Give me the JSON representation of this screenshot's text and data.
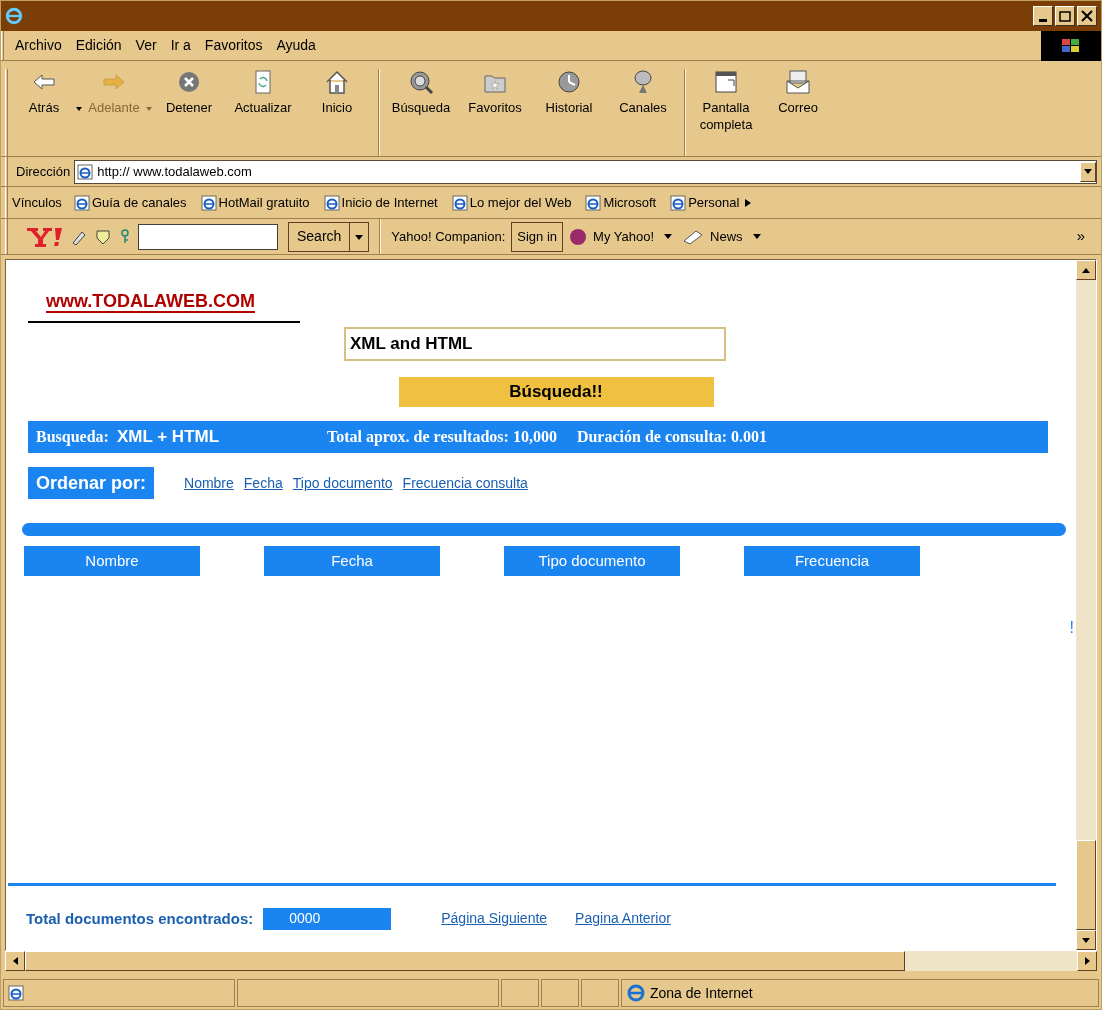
{
  "menu": [
    "Archivo",
    "Edición",
    "Ver",
    "Ir a",
    "Favoritos",
    "Ayuda"
  ],
  "toolbar": [
    {
      "label": "Atrás",
      "kind": "back",
      "disabled": false,
      "dropdown": true
    },
    {
      "label": "Adelante",
      "kind": "forward",
      "disabled": true,
      "dropdown": true
    },
    {
      "label": "Detener",
      "kind": "stop",
      "disabled": false,
      "dropdown": false
    },
    {
      "label": "Actualizar",
      "kind": "refresh",
      "disabled": false,
      "dropdown": false
    },
    {
      "label": "Inicio",
      "kind": "home",
      "disabled": false,
      "dropdown": false
    },
    {
      "label": "Búsqueda",
      "kind": "search",
      "disabled": false,
      "dropdown": false
    },
    {
      "label": "Favoritos",
      "kind": "folder",
      "disabled": false,
      "dropdown": false
    },
    {
      "label": "Historial",
      "kind": "history",
      "disabled": false,
      "dropdown": false
    },
    {
      "label": "Canales",
      "kind": "satellite",
      "disabled": false,
      "dropdown": false
    },
    {
      "label": "Pantalla completa",
      "kind": "fullscreen",
      "disabled": false,
      "dropdown": false
    },
    {
      "label": "Correo",
      "kind": "mail",
      "disabled": false,
      "dropdown": false
    }
  ],
  "address": {
    "label": "Dirección",
    "value": "http:// www.todalaweb.com"
  },
  "links": {
    "label": "Vínculos",
    "items": [
      "Guía de canales",
      "HotMail gratuito",
      "Inicio de Internet",
      "Lo mejor del Web",
      "Microsoft",
      "Personal"
    ]
  },
  "yahoo_bar": {
    "search_button": "Search",
    "companion_label": "Yahoo! Companion:",
    "sign_in": "Sign in",
    "my_yahoo": "My Yahoo!",
    "news": "News",
    "more": "»"
  },
  "page": {
    "site_title": "www.TODALAWEB.COM",
    "query": "XML and HTML",
    "search_button": "Búsqueda!!",
    "summary": {
      "search_label": "Busqueda:",
      "search_terms": "XML + HTML",
      "total": "Total aprox. de resultados: 10,000",
      "duration": "Duración de consulta: 0.001"
    },
    "sort_label": "Ordenar por:",
    "sort_links": [
      "Nombre",
      "Fecha",
      "Tipo documento",
      "Frecuencia consulta"
    ],
    "columns": [
      "Nombre",
      "Fecha",
      "Tipo documento",
      "Frecuencia"
    ],
    "stray_mark": "!",
    "total_label": "Total documentos encontrados:",
    "total_value": "0000",
    "pager": [
      "Página Siguiente",
      "Pagina Anterior"
    ]
  },
  "status_bar": {
    "zone": "Zona de Internet"
  }
}
